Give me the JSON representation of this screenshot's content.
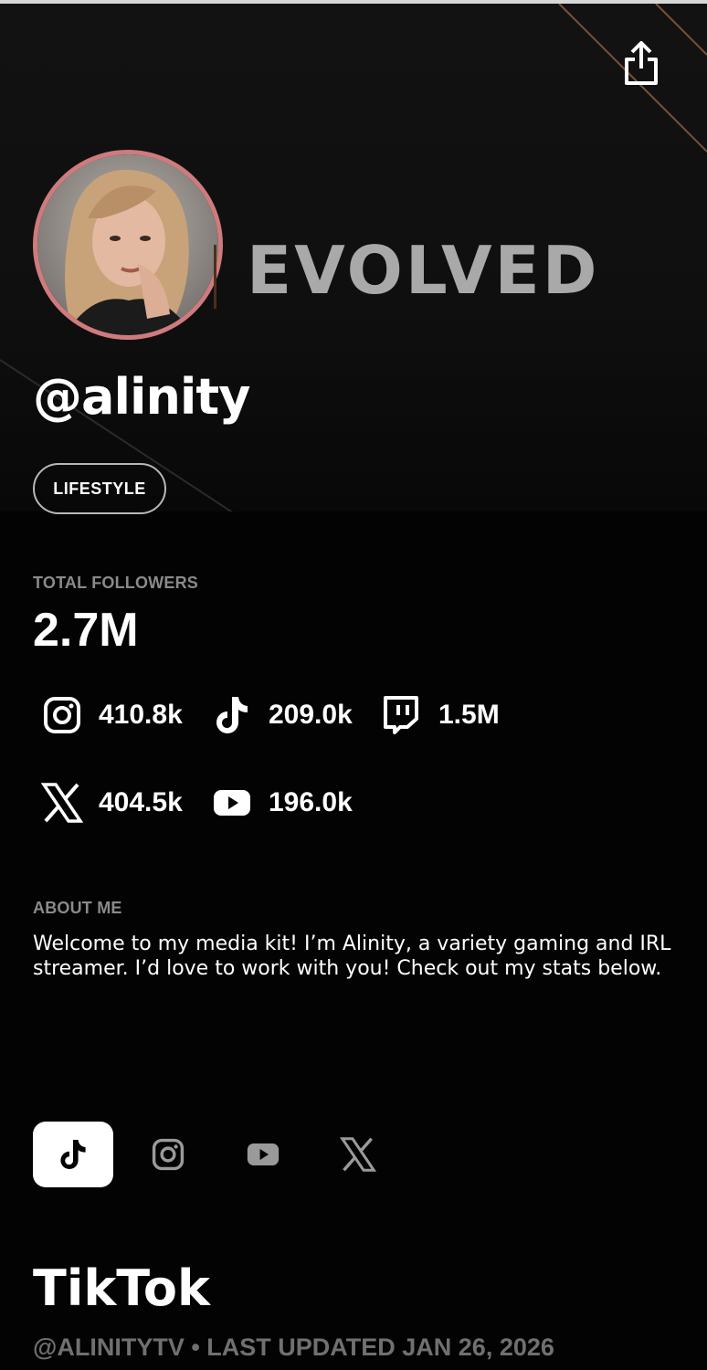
{
  "profile": {
    "handle": "@alinity",
    "brand": "EVOLVED",
    "category": "LIFESTYLE"
  },
  "followers": {
    "label": "TOTAL FOLLOWERS",
    "total": "2.7M",
    "platforms": [
      {
        "name": "Instagram",
        "icon": "instagram-icon",
        "count": "410.8k"
      },
      {
        "name": "TikTok",
        "icon": "tiktok-icon",
        "count": "209.0k"
      },
      {
        "name": "Twitch",
        "icon": "twitch-icon",
        "count": "1.5M"
      },
      {
        "name": "X",
        "icon": "x-icon",
        "count": "404.5k"
      },
      {
        "name": "YouTube",
        "icon": "youtube-icon",
        "count": "196.0k"
      }
    ]
  },
  "about": {
    "label": "ABOUT ME",
    "text": "Welcome to my media kit! I’m Alinity, a variety gaming and IRL streamer. I’d love to work with you! Check out my stats below."
  },
  "tabs": [
    {
      "name": "TikTok",
      "icon": "tiktok-icon",
      "active": true
    },
    {
      "name": "Instagram",
      "icon": "instagram-icon",
      "active": false
    },
    {
      "name": "YouTube",
      "icon": "youtube-icon",
      "active": false
    },
    {
      "name": "X",
      "icon": "x-icon",
      "active": false
    }
  ],
  "section": {
    "title": "TikTok",
    "meta": "@ALINITYTV • LAST UPDATED JAN 26, 2026"
  },
  "colors": {
    "background": "#030303",
    "avatar_ring": "#cf7b7d",
    "muted_text": "#8a8a8a",
    "inactive_icon": "#9a9a9a"
  }
}
